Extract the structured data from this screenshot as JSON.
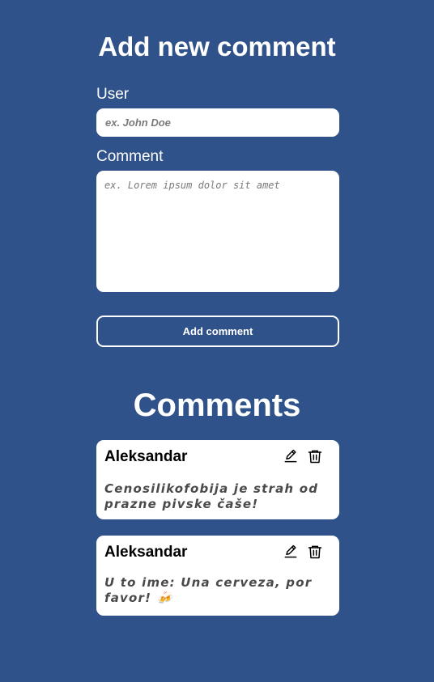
{
  "form": {
    "title": "Add new comment",
    "user_label": "User",
    "user_placeholder": "ex. John Doe",
    "user_value": "",
    "comment_label": "Comment",
    "comment_placeholder": "ex. Lorem ipsum dolor sit amet",
    "comment_value": "",
    "submit_label": "Add comment"
  },
  "comments_section": {
    "title": "Comments",
    "items": [
      {
        "author": "Aleksandar",
        "text": "Cenosilikofobija je strah od prazne pivske čaše!"
      },
      {
        "author": "Aleksandar",
        "text": "U to ime: Una cerveza, por favor! 🍻"
      }
    ]
  },
  "icons": {
    "edit": "pencil-icon",
    "delete": "trash-icon"
  },
  "colors": {
    "background": "#2e5289",
    "card": "#ffffff",
    "text_light": "#ffffff",
    "comment_text": "#4a4a4a"
  }
}
